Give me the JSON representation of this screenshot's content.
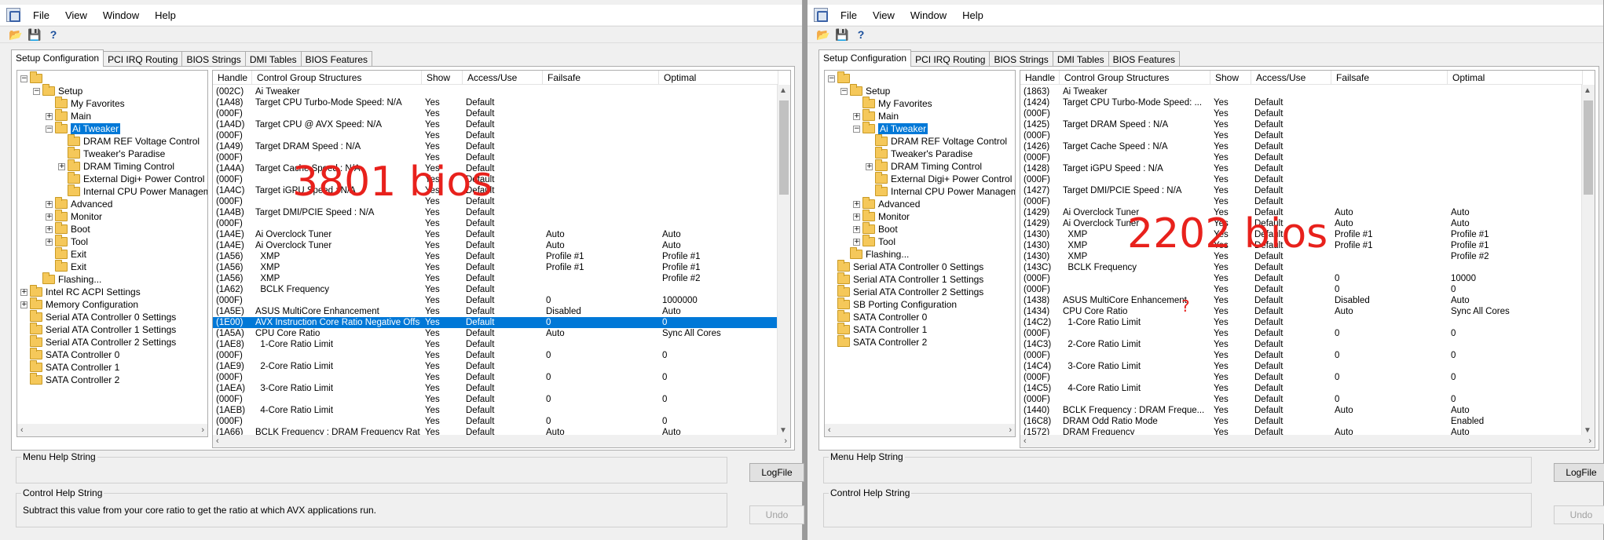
{
  "menu": [
    "File",
    "View",
    "Window",
    "Help"
  ],
  "tabs": [
    "Setup Configuration",
    "PCI IRQ Routing",
    "BIOS Strings",
    "DMI Tables",
    "BIOS Features"
  ],
  "columns": [
    "Handle",
    "Control Group Structures",
    "Show",
    "Access/Use",
    "Failsafe",
    "Optimal"
  ],
  "menu_help_label": "Menu Help String",
  "control_help_label": "Control Help String",
  "logfile_label": "LogFile",
  "undo_label": "Undo",
  "left": {
    "overlay": "3801 bios",
    "control_help_text": "Subtract this value from your core ratio to get the ratio at which AVX applications run.",
    "tree": [
      {
        "label": "",
        "depth": 0,
        "exp": "-"
      },
      {
        "label": "Setup",
        "depth": 1,
        "exp": "-"
      },
      {
        "label": "My Favorites",
        "depth": 2,
        "exp": ""
      },
      {
        "label": "Main",
        "depth": 2,
        "exp": "+"
      },
      {
        "label": "Ai Tweaker",
        "depth": 2,
        "exp": "-",
        "selected": true
      },
      {
        "label": "DRAM REF Voltage Control",
        "depth": 3,
        "exp": ""
      },
      {
        "label": "Tweaker's Paradise",
        "depth": 3,
        "exp": ""
      },
      {
        "label": "DRAM Timing Control",
        "depth": 3,
        "exp": "+"
      },
      {
        "label": "External Digi+ Power Control",
        "depth": 3,
        "exp": ""
      },
      {
        "label": "Internal CPU Power Management",
        "depth": 3,
        "exp": ""
      },
      {
        "label": "Advanced",
        "depth": 2,
        "exp": "+"
      },
      {
        "label": "Monitor",
        "depth": 2,
        "exp": "+"
      },
      {
        "label": "Boot",
        "depth": 2,
        "exp": "+"
      },
      {
        "label": "Tool",
        "depth": 2,
        "exp": "+"
      },
      {
        "label": "Exit",
        "depth": 2,
        "exp": ""
      },
      {
        "label": "Exit",
        "depth": 2,
        "exp": ""
      },
      {
        "label": "Flashing...",
        "depth": 1,
        "exp": ""
      },
      {
        "label": "Intel RC ACPI Settings",
        "depth": 0,
        "exp": "+"
      },
      {
        "label": "Memory Configuration",
        "depth": 0,
        "exp": "+"
      },
      {
        "label": "Serial ATA Controller 0 Settings",
        "depth": 0,
        "exp": ""
      },
      {
        "label": "Serial ATA Controller 1 Settings",
        "depth": 0,
        "exp": ""
      },
      {
        "label": "Serial ATA Controller 2 Settings",
        "depth": 0,
        "exp": ""
      },
      {
        "label": "SATA Controller 0",
        "depth": 0,
        "exp": ""
      },
      {
        "label": "SATA Controller 1",
        "depth": 0,
        "exp": ""
      },
      {
        "label": "SATA Controller 2",
        "depth": 0,
        "exp": ""
      }
    ],
    "rows": [
      [
        "(002C)",
        "Ai Tweaker",
        "",
        "",
        "",
        ""
      ],
      [
        "(1A48)",
        "Target CPU Turbo-Mode Speed: N/A",
        "Yes",
        "Default",
        "",
        ""
      ],
      [
        "(000F)",
        "",
        "Yes",
        "Default",
        "",
        ""
      ],
      [
        "(1A4D)",
        "Target CPU @ AVX Speed: N/A",
        "Yes",
        "Default",
        "",
        ""
      ],
      [
        "(000F)",
        "",
        "Yes",
        "Default",
        "",
        ""
      ],
      [
        "(1A49)",
        "Target DRAM Speed : N/A",
        "Yes",
        "Default",
        "",
        ""
      ],
      [
        "(000F)",
        "",
        "Yes",
        "Default",
        "",
        ""
      ],
      [
        "(1A4A)",
        "Target Cache Speed : N/A",
        "Yes",
        "Default",
        "",
        ""
      ],
      [
        "(000F)",
        "",
        "Yes",
        "Default",
        "",
        ""
      ],
      [
        "(1A4C)",
        "Target iGPU Speed : N/A",
        "Yes",
        "Default",
        "",
        ""
      ],
      [
        "(000F)",
        "",
        "Yes",
        "Default",
        "",
        ""
      ],
      [
        "(1A4B)",
        "Target DMI/PCIE Speed : N/A",
        "Yes",
        "Default",
        "",
        ""
      ],
      [
        "(000F)",
        "",
        "Yes",
        "Default",
        "",
        ""
      ],
      [
        "(1A4E)",
        "Ai Overclock Tuner",
        "Yes",
        "Default",
        "Auto",
        "Auto"
      ],
      [
        "(1A4E)",
        "Ai Overclock Tuner",
        "Yes",
        "Default",
        "Auto",
        "Auto"
      ],
      [
        "(1A56)",
        "  XMP",
        "Yes",
        "Default",
        "Profile #1",
        "Profile #1"
      ],
      [
        "(1A56)",
        "  XMP",
        "Yes",
        "Default",
        "Profile #1",
        "Profile #1"
      ],
      [
        "(1A56)",
        "  XMP",
        "Yes",
        "Default",
        "",
        "Profile #2"
      ],
      [
        "(1A62)",
        "  BCLK Frequency",
        "Yes",
        "Default",
        "",
        ""
      ],
      [
        "(000F)",
        "",
        "Yes",
        "Default",
        "0",
        "1000000"
      ],
      [
        "(1A5E)",
        "ASUS MultiCore Enhancement",
        "Yes",
        "Default",
        "Disabled",
        "Auto"
      ],
      [
        "(1E00)",
        "AVX Instruction Core Ratio Negative Offset",
        "Yes",
        "Default",
        "0",
        "0"
      ],
      [
        "(1A5A)",
        "CPU Core Ratio",
        "Yes",
        "Default",
        "Auto",
        "Sync All Cores"
      ],
      [
        "(1AE8)",
        "  1-Core Ratio Limit",
        "Yes",
        "Default",
        "",
        ""
      ],
      [
        "(000F)",
        "",
        "Yes",
        "Default",
        "0",
        "0"
      ],
      [
        "(1AE9)",
        "  2-Core Ratio Limit",
        "Yes",
        "Default",
        "",
        ""
      ],
      [
        "(000F)",
        "",
        "Yes",
        "Default",
        "0",
        "0"
      ],
      [
        "(1AEA)",
        "  3-Core Ratio Limit",
        "Yes",
        "Default",
        "",
        ""
      ],
      [
        "(000F)",
        "",
        "Yes",
        "Default",
        "0",
        "0"
      ],
      [
        "(1AEB)",
        "  4-Core Ratio Limit",
        "Yes",
        "Default",
        "",
        ""
      ],
      [
        "(000F)",
        "",
        "Yes",
        "Default",
        "0",
        "0"
      ],
      [
        "(1A66)",
        "BCLK Frequency : DRAM Frequency Ratio",
        "Yes",
        "Default",
        "Auto",
        "Auto"
      ]
    ]
  },
  "right": {
    "overlay": "2202 bios",
    "question_mark": "?",
    "control_help_text": "",
    "tree": [
      {
        "label": "",
        "depth": 0,
        "exp": "-"
      },
      {
        "label": "Setup",
        "depth": 1,
        "exp": "-"
      },
      {
        "label": "My Favorites",
        "depth": 2,
        "exp": ""
      },
      {
        "label": "Main",
        "depth": 2,
        "exp": "+"
      },
      {
        "label": "Ai Tweaker",
        "depth": 2,
        "exp": "-",
        "selected": true
      },
      {
        "label": "DRAM REF Voltage Control",
        "depth": 3,
        "exp": ""
      },
      {
        "label": "Tweaker's Paradise",
        "depth": 3,
        "exp": ""
      },
      {
        "label": "DRAM Timing Control",
        "depth": 3,
        "exp": "+"
      },
      {
        "label": "External Digi+ Power Control",
        "depth": 3,
        "exp": ""
      },
      {
        "label": "Internal CPU Power Management",
        "depth": 3,
        "exp": ""
      },
      {
        "label": "Advanced",
        "depth": 2,
        "exp": "+"
      },
      {
        "label": "Monitor",
        "depth": 2,
        "exp": "+"
      },
      {
        "label": "Boot",
        "depth": 2,
        "exp": "+"
      },
      {
        "label": "Tool",
        "depth": 2,
        "exp": "+"
      },
      {
        "label": "Flashing...",
        "depth": 1,
        "exp": ""
      },
      {
        "label": "Serial ATA Controller 0 Settings",
        "depth": 0,
        "exp": ""
      },
      {
        "label": "Serial ATA Controller 1 Settings",
        "depth": 0,
        "exp": ""
      },
      {
        "label": "Serial ATA Controller 2 Settings",
        "depth": 0,
        "exp": ""
      },
      {
        "label": "SB Porting Configuration",
        "depth": 0,
        "exp": ""
      },
      {
        "label": "SATA Controller 0",
        "depth": 0,
        "exp": ""
      },
      {
        "label": "SATA Controller 1",
        "depth": 0,
        "exp": ""
      },
      {
        "label": "SATA Controller 2",
        "depth": 0,
        "exp": ""
      }
    ],
    "rows": [
      [
        "(1863)",
        "Ai Tweaker",
        "",
        "",
        "",
        ""
      ],
      [
        "(1424)",
        "Target CPU Turbo-Mode Speed: ...",
        "Yes",
        "Default",
        "",
        ""
      ],
      [
        "(000F)",
        "",
        "Yes",
        "Default",
        "",
        ""
      ],
      [
        "(1425)",
        "Target DRAM Speed : N/A",
        "Yes",
        "Default",
        "",
        ""
      ],
      [
        "(000F)",
        "",
        "Yes",
        "Default",
        "",
        ""
      ],
      [
        "(1426)",
        "Target Cache Speed : N/A",
        "Yes",
        "Default",
        "",
        ""
      ],
      [
        "(000F)",
        "",
        "Yes",
        "Default",
        "",
        ""
      ],
      [
        "(1428)",
        "Target iGPU Speed : N/A",
        "Yes",
        "Default",
        "",
        ""
      ],
      [
        "(000F)",
        "",
        "Yes",
        "Default",
        "",
        ""
      ],
      [
        "(1427)",
        "Target DMI/PCIE Speed : N/A",
        "Yes",
        "Default",
        "",
        ""
      ],
      [
        "(000F)",
        "",
        "Yes",
        "Default",
        "",
        ""
      ],
      [
        "(1429)",
        "Ai Overclock Tuner",
        "Yes",
        "Default",
        "Auto",
        "Auto"
      ],
      [
        "(1429)",
        "Ai Overclock Tuner",
        "Yes",
        "Default",
        "Auto",
        "Auto"
      ],
      [
        "(1430)",
        "  XMP",
        "Yes",
        "Default",
        "Profile #1",
        "Profile #1"
      ],
      [
        "(1430)",
        "  XMP",
        "Yes",
        "Default",
        "Profile #1",
        "Profile #1"
      ],
      [
        "(1430)",
        "  XMP",
        "Yes",
        "Default",
        "",
        "Profile #2"
      ],
      [
        "(143C)",
        "  BCLK Frequency",
        "Yes",
        "Default",
        "",
        ""
      ],
      [
        "(000F)",
        "",
        "Yes",
        "Default",
        "0",
        "10000"
      ],
      [
        "(000F)",
        "",
        "Yes",
        "Default",
        "0",
        "0"
      ],
      [
        "(1438)",
        "ASUS MultiCore Enhancement",
        "Yes",
        "Default",
        "Disabled",
        "Auto"
      ],
      [
        "(1434)",
        "CPU Core Ratio",
        "Yes",
        "Default",
        "Auto",
        "Sync All Cores"
      ],
      [
        "(14C2)",
        "  1-Core Ratio Limit",
        "Yes",
        "Default",
        "",
        ""
      ],
      [
        "(000F)",
        "",
        "Yes",
        "Default",
        "0",
        "0"
      ],
      [
        "(14C3)",
        "  2-Core Ratio Limit",
        "Yes",
        "Default",
        "",
        ""
      ],
      [
        "(000F)",
        "",
        "Yes",
        "Default",
        "0",
        "0"
      ],
      [
        "(14C4)",
        "  3-Core Ratio Limit",
        "Yes",
        "Default",
        "",
        ""
      ],
      [
        "(000F)",
        "",
        "Yes",
        "Default",
        "0",
        "0"
      ],
      [
        "(14C5)",
        "  4-Core Ratio Limit",
        "Yes",
        "Default",
        "",
        ""
      ],
      [
        "(000F)",
        "",
        "Yes",
        "Default",
        "0",
        "0"
      ],
      [
        "(1440)",
        "BCLK Frequency : DRAM Freque...",
        "Yes",
        "Default",
        "Auto",
        "Auto"
      ],
      [
        "(16C8)",
        "DRAM Odd Ratio Mode",
        "Yes",
        "Default",
        "",
        "Enabled"
      ],
      [
        "(1572)",
        "DRAM Frequency",
        "Yes",
        "Default",
        "Auto",
        "Auto"
      ]
    ]
  }
}
